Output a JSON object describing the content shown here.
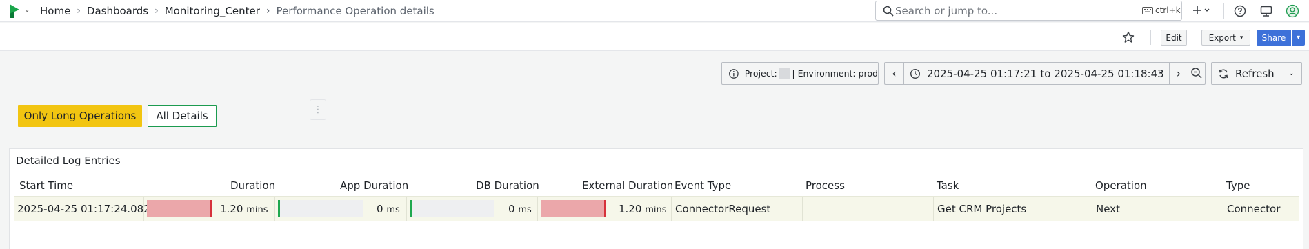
{
  "nav": {
    "breadcrumbs": [
      "Home",
      "Dashboards",
      "Monitoring_Center"
    ],
    "current_page": "Performance Operation details",
    "search_placeholder": "Search or jump to...",
    "search_shortcut": "ctrl+k"
  },
  "toolbar": {
    "edit_label": "Edit",
    "export_label": "Export",
    "share_label": "Share"
  },
  "controls": {
    "project_label": "Project:",
    "environment_label": "| Environment: prod",
    "time_range_start": "2025-04-25 01:17:21",
    "time_range_to": "to",
    "time_range_end": "2025-04-25 01:18:43",
    "refresh_label": "Refresh"
  },
  "filters": {
    "long_ops_label": "Only Long Operations",
    "all_details_label": "All Details"
  },
  "panel": {
    "title": "Detailed Log Entries",
    "columns": [
      "Start Time",
      "Duration",
      "App Duration",
      "DB Duration",
      "External Duration",
      "Event Type",
      "Process",
      "Task",
      "Operation",
      "Type"
    ],
    "rows": [
      {
        "start_time": "2025-04-25 01:17:24.082",
        "duration_value": "1.20",
        "duration_unit": "mins",
        "duration_fill": 1.0,
        "app_duration_value": "0",
        "app_duration_unit": "ms",
        "app_duration_fill": 0.0,
        "db_duration_value": "0",
        "db_duration_unit": "ms",
        "db_duration_fill": 0.0,
        "external_duration_value": "1.20",
        "external_duration_unit": "mins",
        "external_duration_fill": 1.0,
        "event_type": "ConnectorRequest",
        "process": "",
        "task": "Get CRM Projects",
        "operation": "Next",
        "type": "Connector"
      }
    ]
  },
  "colors": {
    "accent_yellow": "#f2c511",
    "accent_green": "#1c9b4f",
    "bar_red": "#eba7aa",
    "bar_red_mark": "#d6313b",
    "bar_green_mark": "#1fa84f",
    "share_blue": "#3d71d9"
  },
  "icons": [
    "app-logo-icon",
    "search-icon",
    "keyboard-icon",
    "plus-icon",
    "help-icon",
    "news-icon",
    "user-icon",
    "star-icon",
    "info-icon",
    "clock-icon",
    "zoom-out-icon",
    "refresh-icon"
  ]
}
